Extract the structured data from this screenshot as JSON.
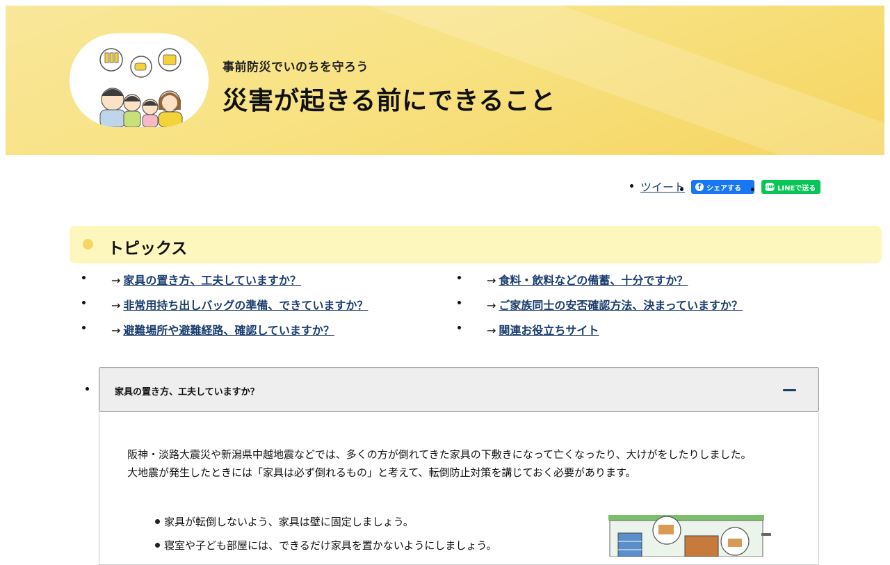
{
  "hero": {
    "subtitle": "事前防災でいのちを守ろう",
    "title": "災害が起きる前にできること"
  },
  "share": {
    "tweet": "ツイート",
    "facebook": "シェアする",
    "line": "LINEで送る"
  },
  "topics": {
    "heading": "トピックス",
    "arrow": "→",
    "left": [
      "家具の置き方、工夫していますか？",
      "非常用持ち出しバッグの準備、できていますか？",
      "避難場所や避難経路、確認していますか？"
    ],
    "right": [
      "食料・飲料などの備蓄、十分ですか？",
      "ご家族同士の安否確認方法、決まっていますか？",
      "関連お役立ちサイト"
    ]
  },
  "accordion": {
    "title": "家具の置き方、工夫していますか？",
    "para1": "阪神・淡路大震災や新潟県中越地震などでは、多くの方が倒れてきた家具の下敷きになって亡くなったり、大けがをしたりしました。",
    "para2": "大地震が発生したときには「家具は必ず倒れるもの」と考えて、転倒防止対策を講じておく必要があります。",
    "items": [
      "家具が転倒しないよう、家具は壁に固定しましょう。",
      "寝室や子ども部屋には、できるだけ家具を置かないようにしましょう。"
    ]
  },
  "colors": {
    "hero_bg": "#f7df7a",
    "link": "#1a3d6e",
    "topics_bg": "#fdf6bd",
    "facebook": "#1877f2",
    "line": "#06c755"
  }
}
